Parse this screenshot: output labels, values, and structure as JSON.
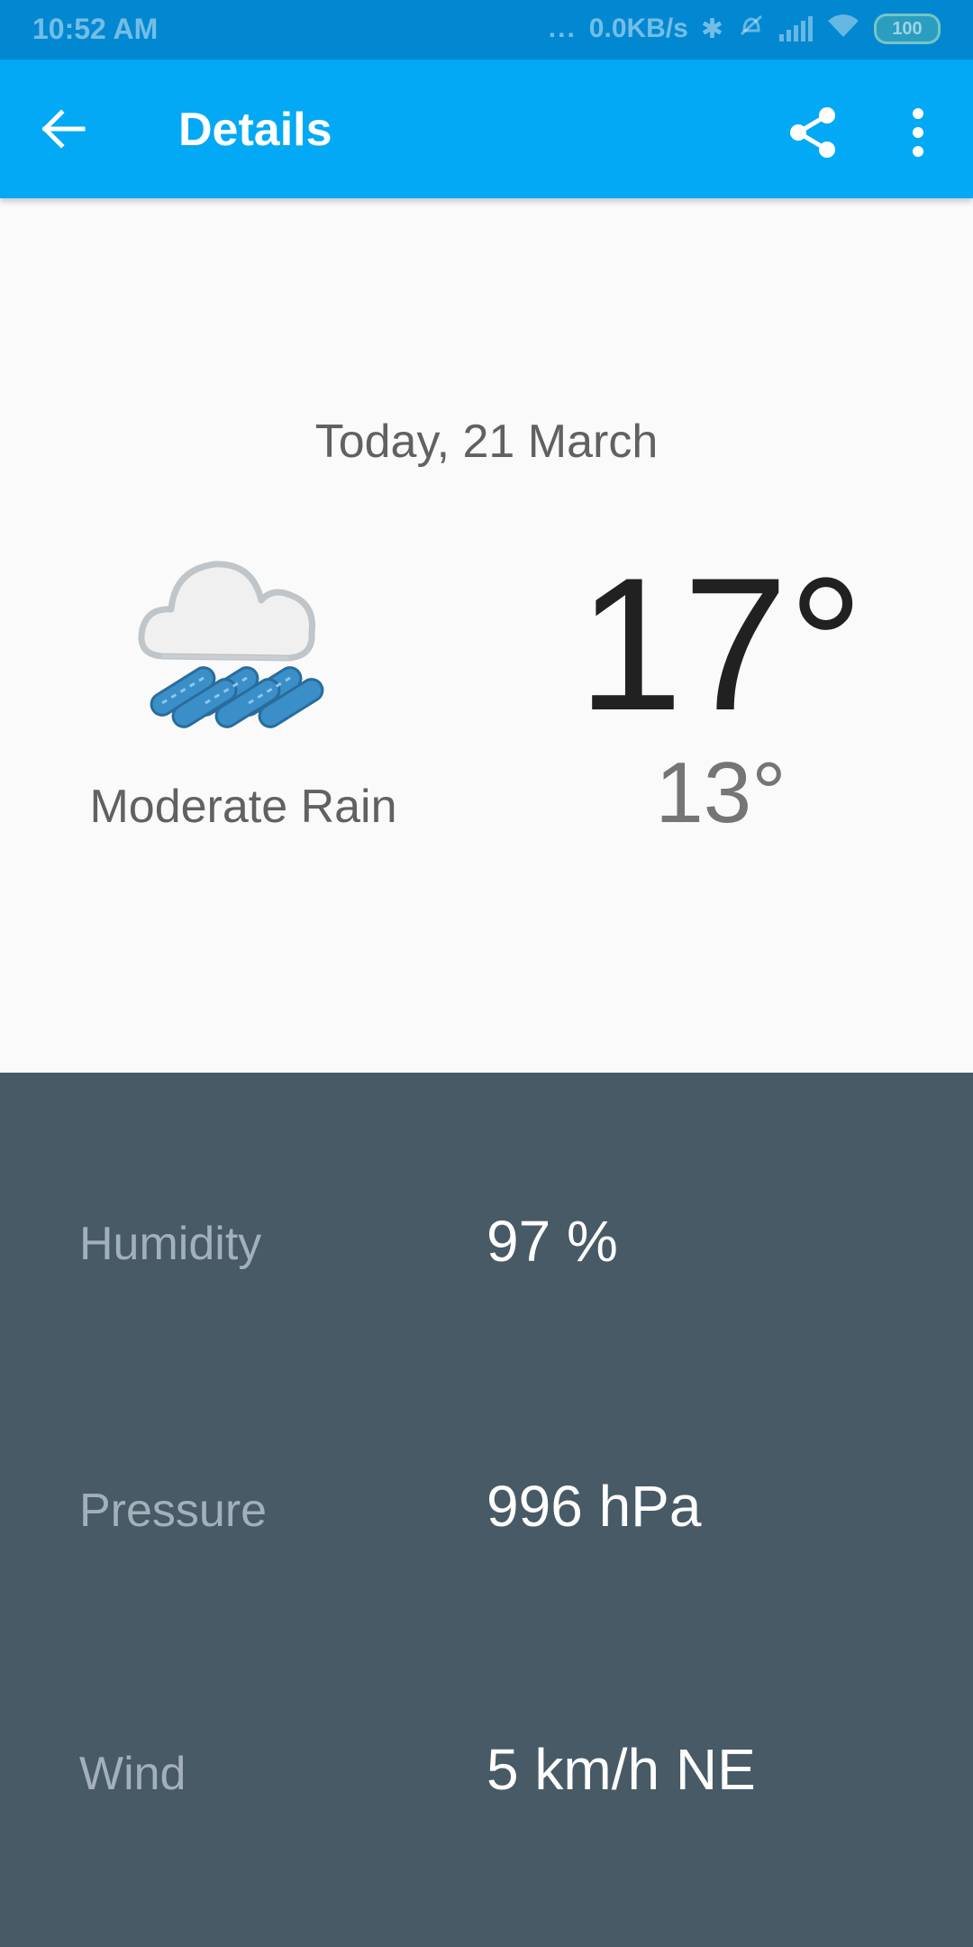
{
  "status_bar": {
    "time": "10:52 AM",
    "dots": "...",
    "speed": "0.0KB/s",
    "battery": "100"
  },
  "app_bar": {
    "title": "Details"
  },
  "forecast": {
    "date": "Today, 21 March",
    "condition": "Moderate Rain",
    "high": "17°",
    "low": "13°",
    "icon": "cloud-rain-icon"
  },
  "details": [
    {
      "label": "Humidity",
      "value": "97 %"
    },
    {
      "label": "Pressure",
      "value": "996 hPa"
    },
    {
      "label": "Wind",
      "value": "5 km/h NE"
    }
  ],
  "colors": {
    "status_bar": "#0288d1",
    "app_bar": "#03a9f4",
    "details_background": "#475a66",
    "rain": "#3a8fc8"
  }
}
